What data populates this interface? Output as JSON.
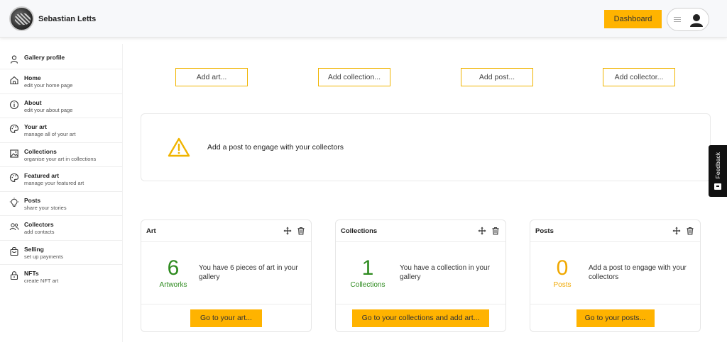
{
  "header": {
    "brand_name": "Sebastian Letts",
    "dashboard_label": "Dashboard"
  },
  "sidebar": {
    "items": [
      {
        "title": "Gallery profile",
        "sub": "",
        "icon": "person-icon"
      },
      {
        "title": "Home",
        "sub": "edit your home page",
        "icon": "home-icon"
      },
      {
        "title": "About",
        "sub": "edit your about page",
        "icon": "info-icon"
      },
      {
        "title": "Your art",
        "sub": "manage all of your art",
        "icon": "palette-icon"
      },
      {
        "title": "Collections",
        "sub": "organise your art in collections",
        "icon": "image-icon"
      },
      {
        "title": "Featured art",
        "sub": "manage your featured art",
        "icon": "palette-icon"
      },
      {
        "title": "Posts",
        "sub": "share your stories",
        "icon": "bulb-icon"
      },
      {
        "title": "Collectors",
        "sub": "add contacts",
        "icon": "people-icon"
      },
      {
        "title": "Selling",
        "sub": "set up payments",
        "icon": "bag-icon"
      },
      {
        "title": "NFTs",
        "sub": "create NFT art",
        "icon": "lock-icon"
      }
    ]
  },
  "actions": {
    "add_art": "Add art...",
    "add_collection": "Add collection...",
    "add_post": "Add post...",
    "add_collector": "Add collector..."
  },
  "notice": {
    "text": "Add a post to engage with your collectors"
  },
  "cards": {
    "art": {
      "title": "Art",
      "count": "6",
      "count_label": "Artworks",
      "message": "You have 6 pieces of art in your gallery",
      "button": "Go to your art...",
      "color": "#2e8b1f"
    },
    "collections": {
      "title": "Collections",
      "count": "1",
      "count_label": "Collections",
      "message": "You have a collection in your gallery",
      "button": "Go to your collections and add art...",
      "color": "#2e8b1f"
    },
    "posts": {
      "title": "Posts",
      "count": "0",
      "count_label": "Posts",
      "message": "Add a post to engage with your collectors",
      "button": "Go to your posts...",
      "color": "#f0a800"
    }
  },
  "feedback": {
    "label": "Feedback"
  },
  "colors": {
    "accent": "#ffb300",
    "success": "#2e8b1f",
    "warning": "#f0a800"
  }
}
